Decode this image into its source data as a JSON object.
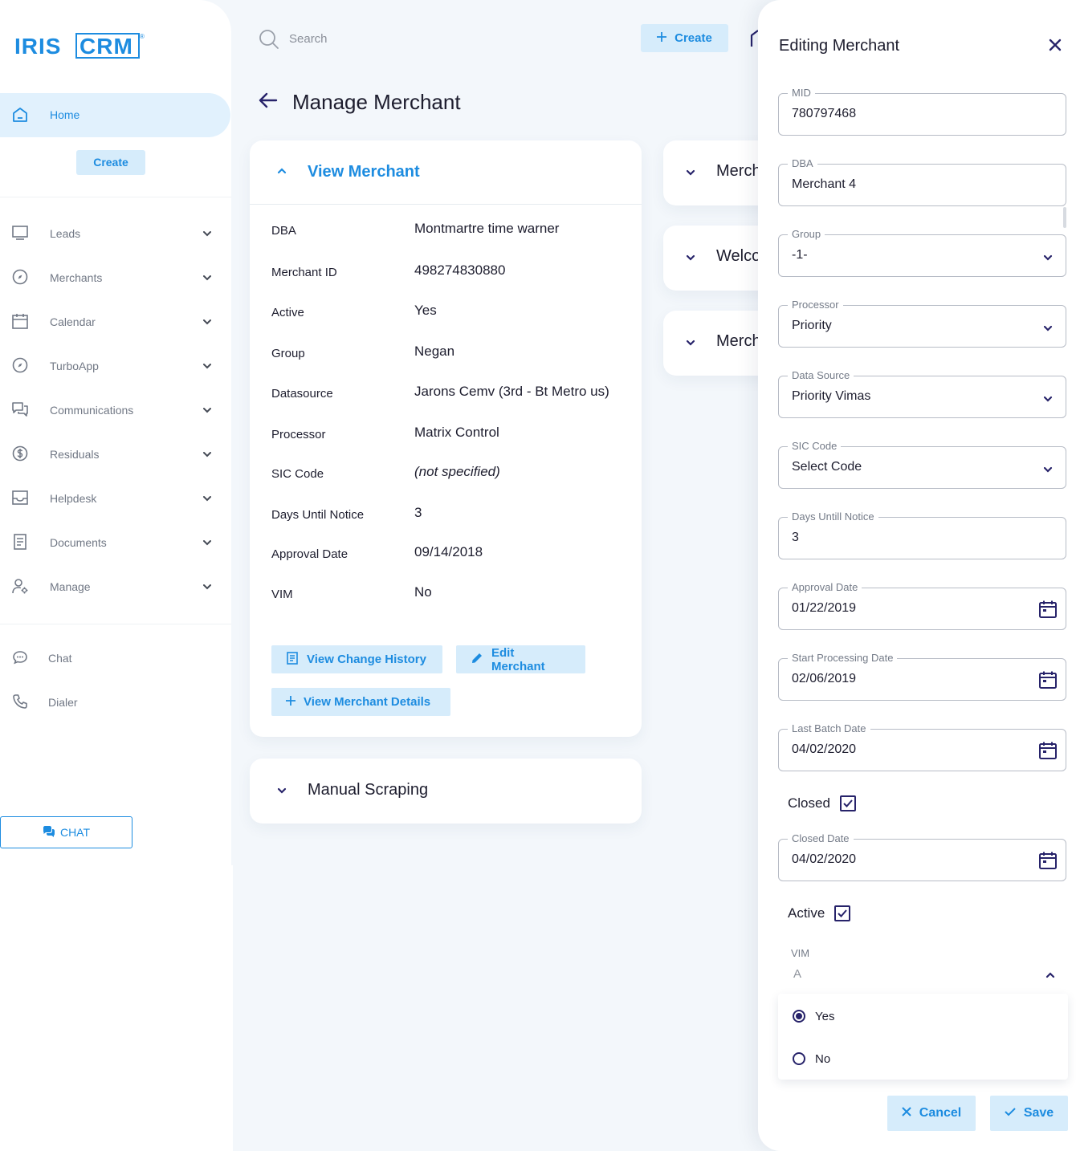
{
  "app": {
    "logo_text_left": "IRIS",
    "logo_text_right": "CRM",
    "logo_mark": "®"
  },
  "colors": {
    "accent": "#1d8ce0",
    "accent_light": "#d6ecfb",
    "dark_navy": "#27236a"
  },
  "sidebar": {
    "home_label": "Home",
    "create_label": "Create",
    "items": [
      {
        "label": "Leads",
        "icon": "monitor-icon"
      },
      {
        "label": "Merchants",
        "icon": "compass-icon"
      },
      {
        "label": "Calendar",
        "icon": "calendar-icon"
      },
      {
        "label": "TurboApp",
        "icon": "compass-icon"
      },
      {
        "label": "Communications",
        "icon": "chat-bubbles-icon"
      },
      {
        "label": "Residuals",
        "icon": "dollar-circle-icon"
      },
      {
        "label": "Helpdesk",
        "icon": "inbox-icon"
      },
      {
        "label": "Documents",
        "icon": "document-icon"
      },
      {
        "label": "Manage",
        "icon": "user-gear-icon"
      }
    ],
    "extra": [
      {
        "label": "Chat",
        "icon": "speech-bubble-icon"
      },
      {
        "label": "Dialer",
        "icon": "phone-icon"
      }
    ],
    "chat_button_label": "CHAT"
  },
  "topbar": {
    "search_placeholder": "Search",
    "create_label": "Create"
  },
  "page": {
    "title": "Manage Merchant"
  },
  "view_card": {
    "title": "View Merchant",
    "rows": [
      {
        "label": "DBA",
        "value": "Montmartre time warner"
      },
      {
        "label": "Merchant ID",
        "value": "498274830880"
      },
      {
        "label": "Active",
        "value": "Yes"
      },
      {
        "label": "Group",
        "value": "Negan"
      },
      {
        "label": "Datasource",
        "value": "Jarons Cemv (3rd - Bt Metro us)"
      },
      {
        "label": "Processor",
        "value": "Matrix Control"
      },
      {
        "label": "SIC Code",
        "value": "(not specified)"
      },
      {
        "label": "Days Until Notice",
        "value": "3"
      },
      {
        "label": "Approval Date",
        "value": "09/14/2018"
      },
      {
        "label": "VIM",
        "value": "No"
      }
    ],
    "btn_history": "View Change History",
    "btn_edit": "Edit Merchant",
    "btn_details": "View Merchant Details"
  },
  "scrape_card": {
    "title": "Manual Scraping"
  },
  "right_cards": [
    "Merch",
    "Welco",
    "Merch"
  ],
  "drawer": {
    "title": "Editing Merchant",
    "fields": [
      {
        "label": "MID",
        "value": "780797468",
        "kind": "text"
      },
      {
        "label": "DBA",
        "value": "Merchant 4",
        "kind": "text"
      },
      {
        "label": "Group",
        "value": "-1-",
        "kind": "select"
      },
      {
        "label": "Processor",
        "value": "Priority",
        "kind": "select"
      },
      {
        "label": "Data Source",
        "value": "Priority Vimas",
        "kind": "select"
      },
      {
        "label": "SIC Code",
        "value": "Select Code",
        "kind": "select"
      },
      {
        "label": "Days Untill Notice",
        "value": "3",
        "kind": "text"
      },
      {
        "label": "Approval Date",
        "value": "01/22/2019",
        "kind": "date"
      },
      {
        "label": "Start Processing Date",
        "value": "02/06/2019",
        "kind": "date"
      },
      {
        "label": "Last Batch Date",
        "value": "04/02/2020",
        "kind": "date"
      }
    ],
    "closed_label": "Closed",
    "closed_checked": true,
    "closed_date_label": "Closed Date",
    "closed_date_value": "04/02/2020",
    "active_label": "Active",
    "active_checked": true,
    "vim_label": "VIM",
    "vim_value": "A",
    "vim_options": [
      {
        "label": "Yes",
        "selected": true
      },
      {
        "label": "No",
        "selected": false
      }
    ],
    "cancel_label": "Cancel",
    "save_label": "Save"
  }
}
